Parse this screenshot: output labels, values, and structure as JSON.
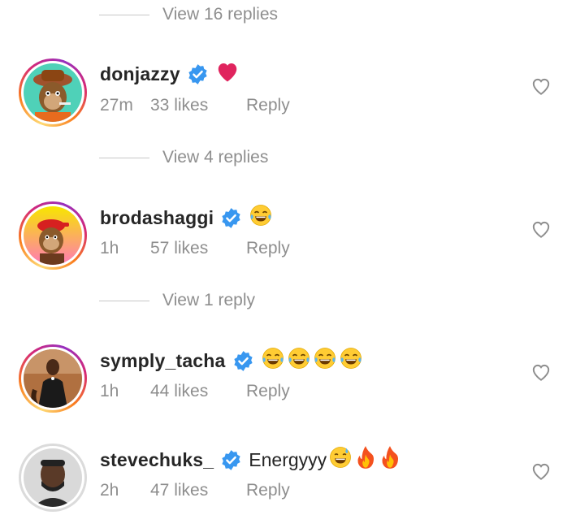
{
  "reply_threads": [
    {
      "label": "View 16 replies"
    },
    {
      "label": "View 4 replies"
    },
    {
      "label": "View 1 reply"
    }
  ],
  "comments": [
    {
      "username": "donjazzy",
      "verified": true,
      "text": "",
      "emojis": [
        "red-heart"
      ],
      "time": "27m",
      "likes": "33 likes",
      "reply_label": "Reply",
      "avatar": "cartoon-ape-avatar"
    },
    {
      "username": "brodashaggi",
      "verified": true,
      "text": "",
      "emojis": [
        "tears-of-joy"
      ],
      "time": "1h",
      "likes": "57 likes",
      "reply_label": "Reply",
      "avatar": "cartoon-ape-red-cap-avatar"
    },
    {
      "username": "symply_tacha",
      "verified": true,
      "text": "",
      "emojis": [
        "tears-of-joy",
        "tears-of-joy",
        "tears-of-joy",
        "tears-of-joy"
      ],
      "time": "1h",
      "likes": "44 likes",
      "reply_label": "Reply",
      "avatar": "photo-avatar"
    },
    {
      "username": "stevechuks_",
      "verified": true,
      "text": "Energyyy",
      "emojis": [
        "grinning-sweat",
        "fire",
        "fire"
      ],
      "time": "2h",
      "likes": "47 likes",
      "reply_label": "Reply",
      "avatar": "photo-avatar"
    }
  ],
  "colors": {
    "text": "#262626",
    "muted": "#8e8e8e",
    "verified_blue": "#3897f0",
    "heart_red": "#ed4956"
  }
}
